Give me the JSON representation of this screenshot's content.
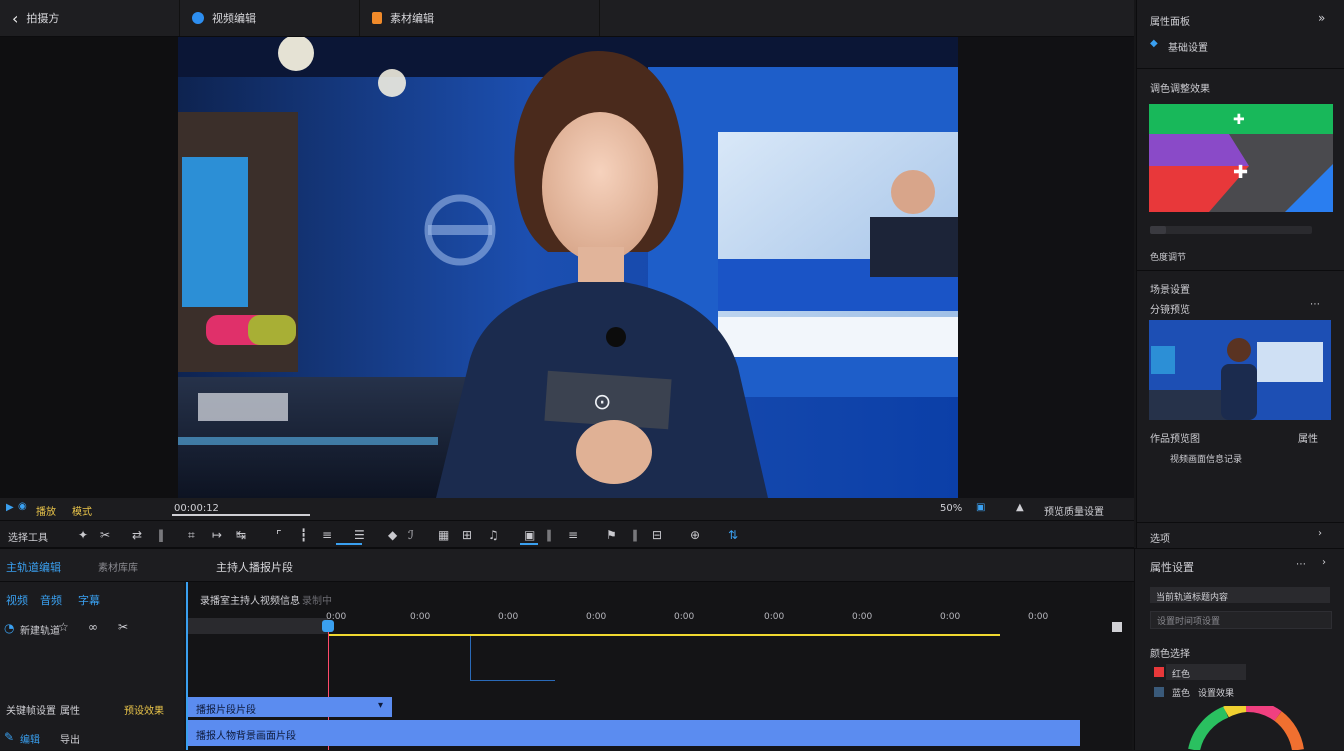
{
  "top_tabs": [
    {
      "label": "拍摄方"
    },
    {
      "label": "视频编辑"
    },
    {
      "label": "素材编辑"
    }
  ],
  "right_panel": {
    "title": "属性面板",
    "subtitle": "基础设置",
    "color_section": "调色调整效果",
    "color_slider_label": "色度调节",
    "scene_section": "场景设置",
    "preview_label": "分镜预览",
    "preview_caption": "作品预览图",
    "preview_caption_right": "属性",
    "preview_info": "视频画面信息记录",
    "collapse_label": "选项"
  },
  "preview_bar": {
    "left_label": "播放",
    "mode_label": "模式",
    "time": "00:00:12",
    "zoom": "50%",
    "quality": "预览质量设置"
  },
  "toolbar": {
    "label": "选择工具"
  },
  "bottom_left": {
    "tab_active": "主轨道编辑",
    "tab_inactive": "素材库库",
    "row1": [
      "视频",
      "音频",
      "字幕"
    ],
    "row2": "新建轨道",
    "row3_left": "关键帧设置",
    "row3_mid": "属性",
    "row3_right": "预设效果",
    "row4": [
      "编辑",
      "导出"
    ]
  },
  "timeline": {
    "title": "主持人播报片段",
    "track_label": "录播室主持人视频信息",
    "track_sub": "录制中",
    "ticks": [
      "0:00",
      "0:00",
      "0:00",
      "0:00",
      "0:00",
      "0:00",
      "0:00",
      "0:00",
      "0:00"
    ],
    "clip1": "播报片段片段",
    "clip2": "播报人物背景画面片段"
  },
  "bottom_right": {
    "title": "属性设置",
    "field1": "当前轨道标题内容",
    "field2": "设置时间项设置",
    "section": "颜色选择",
    "swatch1": "红色",
    "swatch2": "蓝色",
    "swatch2_value": "设置效果"
  },
  "colors": {
    "accent": "#3aa0f0",
    "playhead": "#ff4a6a",
    "clip": "#5b8cf0",
    "timeline_bar": "#f0d830"
  }
}
